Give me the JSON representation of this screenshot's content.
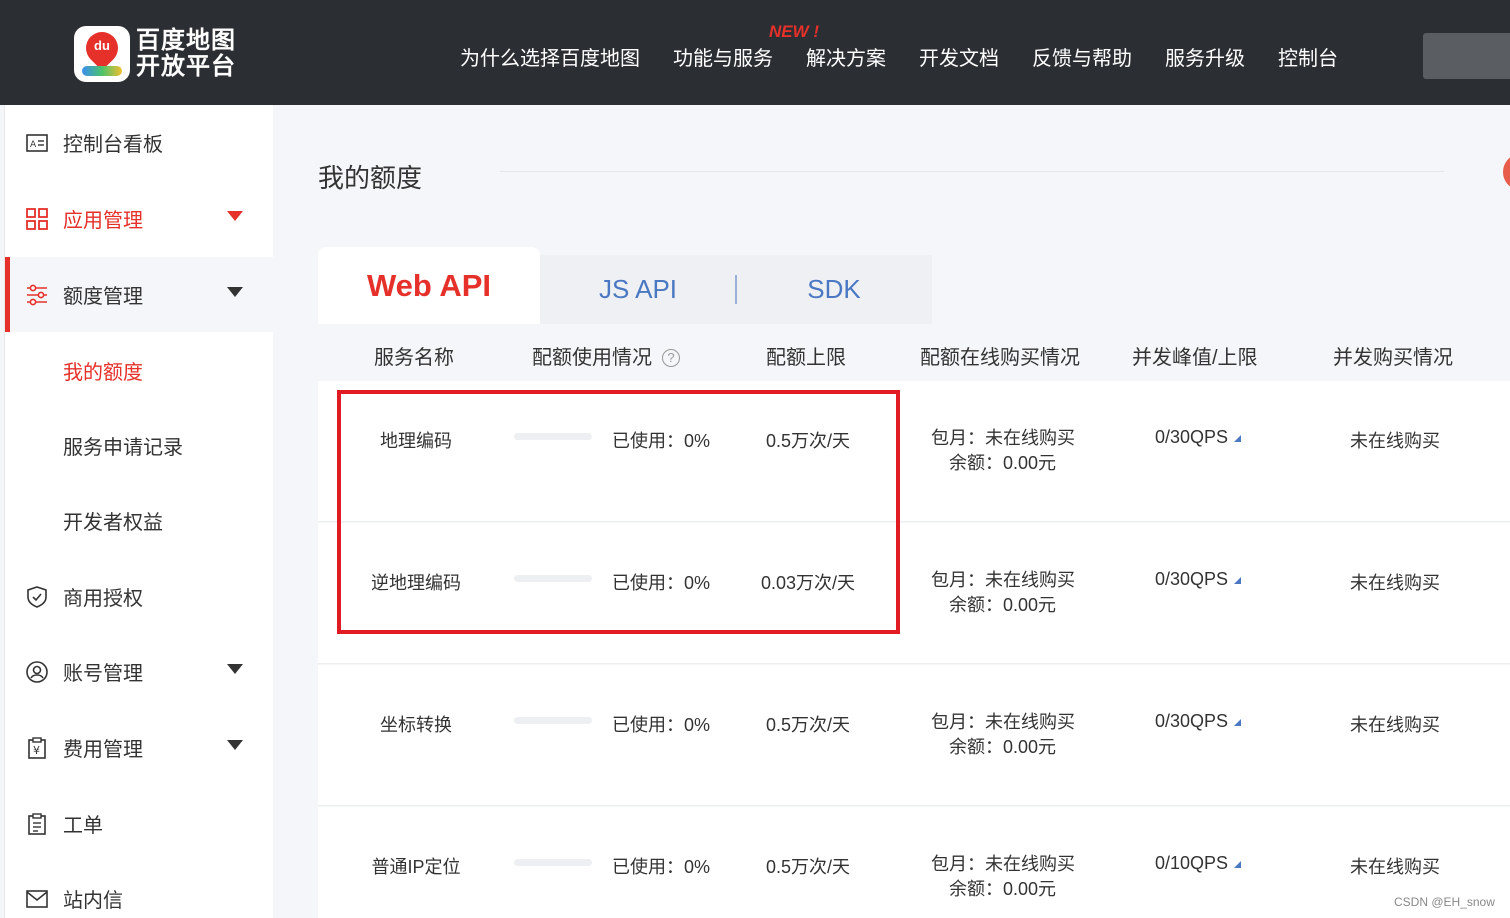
{
  "logo": {
    "line1": "百度地图",
    "line2": "开放平台",
    "mark": "du"
  },
  "nav": {
    "items": [
      "为什么选择百度地图",
      "功能与服务",
      "解决方案",
      "开发文档",
      "反馈与帮助",
      "服务升级",
      "控制台"
    ],
    "badge": "NEW !"
  },
  "sidebar": {
    "dashboard": "控制台看板",
    "app_manage": "应用管理",
    "quota_manage": "额度管理",
    "my_quota": "我的额度",
    "service_apply": "服务申请记录",
    "dev_rights": "开发者权益",
    "commercial": "商用授权",
    "account": "账号管理",
    "fees": "费用管理",
    "tickets": "工单",
    "messages": "站内信"
  },
  "page": {
    "title": "我的额度"
  },
  "tabs": {
    "web": "Web API",
    "js": "JS API",
    "sdk": "SDK"
  },
  "table": {
    "headers": [
      "服务名称",
      "配额使用情况",
      "配额上限",
      "配额在线购买情况",
      "并发峰值/上限",
      "并发购买情况"
    ],
    "help": "?",
    "rows": [
      {
        "name": "地理编码",
        "used": "已使用：0%",
        "usage": 0,
        "limit": "0.5万次/天",
        "buy1": "包月：未在线购买",
        "buy2": "余额：0.00元",
        "qps": "0/30QPS",
        "concurrent": "未在线购买"
      },
      {
        "name": "逆地理编码",
        "used": "已使用：0%",
        "usage": 0,
        "limit": "0.03万次/天",
        "buy1": "包月：未在线购买",
        "buy2": "余额：0.00元",
        "qps": "0/30QPS",
        "concurrent": "未在线购买"
      },
      {
        "name": "坐标转换",
        "used": "已使用：0%",
        "usage": 0,
        "limit": "0.5万次/天",
        "buy1": "包月：未在线购买",
        "buy2": "余额：0.00元",
        "qps": "0/30QPS",
        "concurrent": "未在线购买"
      },
      {
        "name": "普通IP定位",
        "used": "已使用：0%",
        "usage": 0,
        "limit": "0.5万次/天",
        "buy1": "包月：未在线购买",
        "buy2": "余额：0.00元",
        "qps": "0/10QPS",
        "concurrent": "未在线购买"
      }
    ]
  },
  "watermark": "CSDN @EH_snow",
  "colors": {
    "accent": "#e6302a",
    "highlight": "#e11b22",
    "link": "#4a78c2",
    "topbar": "#2b2e33"
  }
}
